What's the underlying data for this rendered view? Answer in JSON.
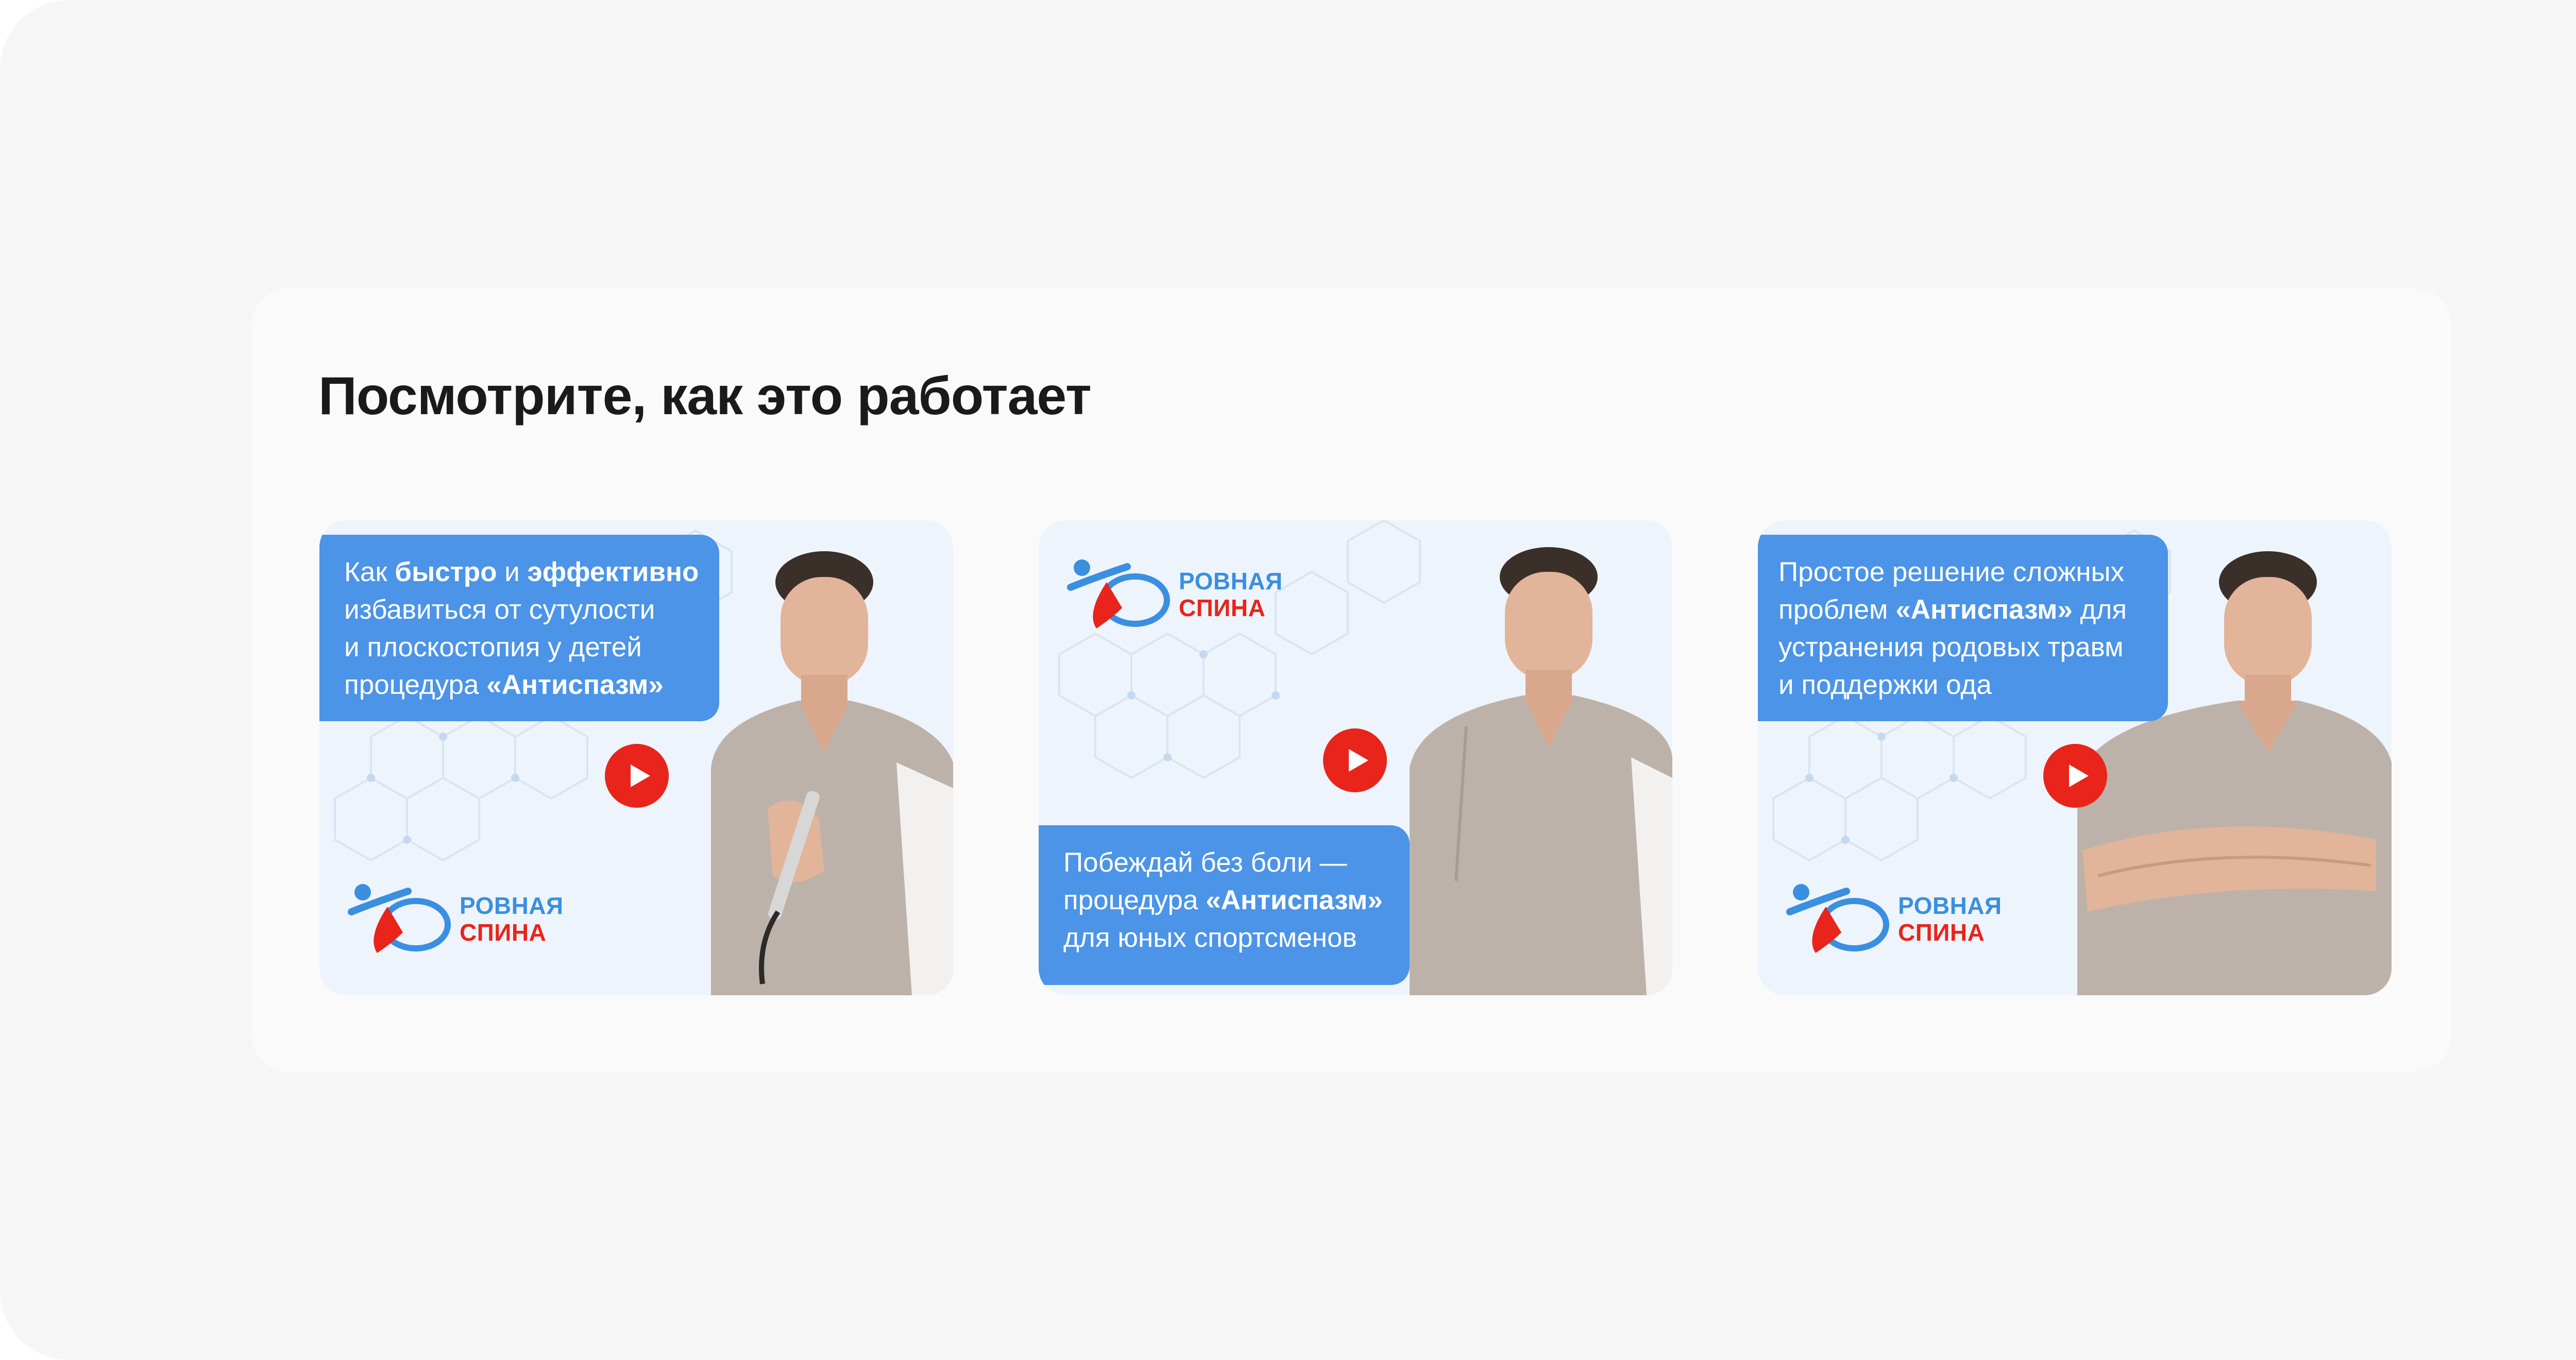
{
  "section": {
    "title": "Посмотрите, как это работает"
  },
  "brand": {
    "word1": "РОВНАЯ",
    "word2": "СПИНА",
    "colors": {
      "blue": "#3a8fe0",
      "red": "#e8241b"
    }
  },
  "colors": {
    "caption_bg": "#4b94e8",
    "play_button": "#e8241b",
    "page_bg": "#f6f6f6",
    "card_bg": "#fafafa"
  },
  "videos": [
    {
      "caption_lines": [
        {
          "a": "Как ",
          "b": "быстро",
          "c": " и ",
          "d": "эффективно",
          "e": ""
        },
        {
          "a": "избавиться от сутулости",
          "b": "",
          "c": "",
          "d": "",
          "e": ""
        },
        {
          "a": "и плоскостопия у детей",
          "b": "",
          "c": "",
          "d": "",
          "e": ""
        },
        {
          "a": "процедура ",
          "b": "«Антиспазм»",
          "c": "",
          "d": "",
          "e": ""
        }
      ],
      "play_icon": "play-icon",
      "person_pose": "holding-device"
    },
    {
      "caption_lines": [
        {
          "a": "Побеждай без боли —",
          "b": "",
          "c": "",
          "d": "",
          "e": ""
        },
        {
          "a": "процедура ",
          "b": "«Антиспазм»",
          "c": "",
          "d": "",
          "e": ""
        },
        {
          "a": "для юных спортсменов",
          "b": "",
          "c": "",
          "d": "",
          "e": ""
        }
      ],
      "play_icon": "play-icon",
      "person_pose": "standing"
    },
    {
      "caption_lines": [
        {
          "a": "Простое решение сложных",
          "b": "",
          "c": "",
          "d": "",
          "e": ""
        },
        {
          "a": "проблем ",
          "b": "«Антиспазм»",
          "c": " для",
          "d": "",
          "e": ""
        },
        {
          "a": "устранения родовых травм",
          "b": "",
          "c": "",
          "d": "",
          "e": ""
        },
        {
          "a": "и поддержки ода",
          "b": "",
          "c": "",
          "d": "",
          "e": ""
        }
      ],
      "play_icon": "play-icon",
      "person_pose": "arms-crossed"
    }
  ]
}
